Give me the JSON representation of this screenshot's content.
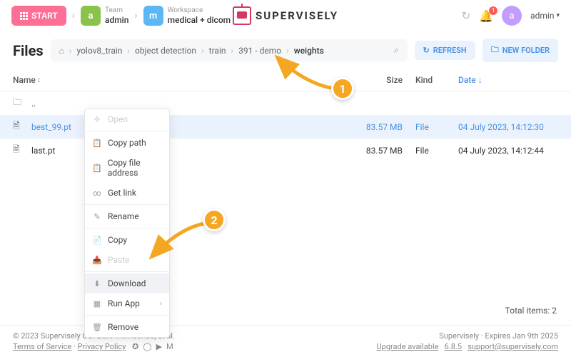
{
  "header": {
    "start_label": "START",
    "team_label": "Team",
    "team_value": "admin",
    "team_letter": "a",
    "workspace_label": "Workspace",
    "workspace_value": "medical + dicom",
    "workspace_letter": "m",
    "brand": "SUPERVISELY",
    "notif_count": "1",
    "user_letter": "a",
    "user_name": "admin"
  },
  "pathbar": {
    "title": "Files",
    "crumbs": [
      "yolov8_train",
      "object detection",
      "train",
      "391 - demo",
      "weights"
    ],
    "refresh": "REFRESH",
    "new_folder": "NEW FOLDER"
  },
  "columns": {
    "name": "Name",
    "size": "Size",
    "kind": "Kind",
    "date": "Date"
  },
  "rows": [
    {
      "type": "up",
      "name": ".."
    },
    {
      "type": "file-sel",
      "name": "best_99.pt",
      "size": "83.57 MB",
      "kind": "File",
      "date": "04 July 2023, 14:12:30"
    },
    {
      "type": "file",
      "name": "last.pt",
      "size": "83.57 MB",
      "kind": "File",
      "date": "04 July 2023, 14:12:44"
    }
  ],
  "context_menu": {
    "open": "Open",
    "copy_path": "Copy path",
    "copy_addr": "Copy file address",
    "get_link": "Get link",
    "rename": "Rename",
    "copy": "Copy",
    "paste": "Paste",
    "download": "Download",
    "run_app": "Run App",
    "remove": "Remove"
  },
  "callouts": {
    "one": "1",
    "two": "2"
  },
  "total": "Total items: 2",
  "footer": {
    "copyright": "© 2023 Supervisely OÜ. Built with icons8, et al.",
    "tos": "Terms of Service",
    "privacy": "Privacy Policy",
    "brand_line": "Supervisely · Expires Jan 9th 2025",
    "upgrade": "Upgrade available",
    "version": "6.8.5",
    "support": "support@supervisely.com"
  }
}
